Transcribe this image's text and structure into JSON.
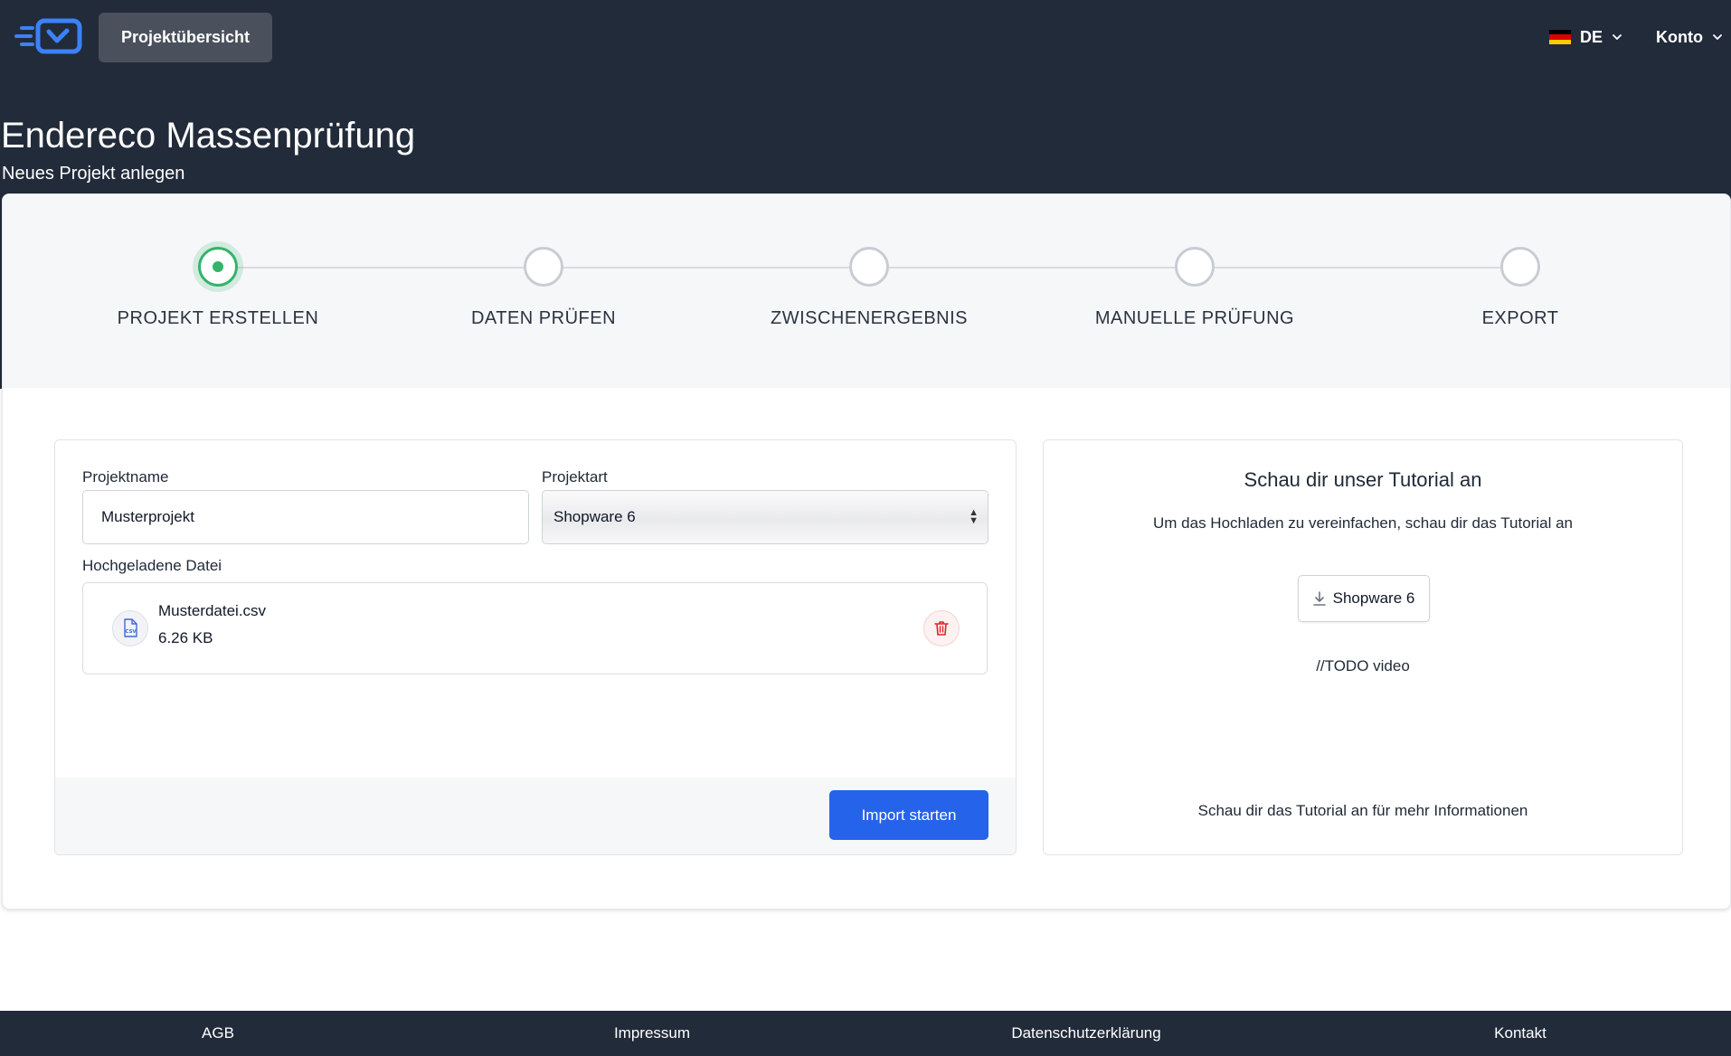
{
  "header": {
    "nav_button": "Projektübersicht",
    "language": "DE",
    "account": "Konto",
    "title": "Endereco Massenprüfung",
    "subtitle": "Neues Projekt anlegen"
  },
  "steps": [
    {
      "label": "PROJEKT ERSTELLEN",
      "active": true
    },
    {
      "label": "DATEN PRÜFEN",
      "active": false
    },
    {
      "label": "ZWISCHENERGEBNIS",
      "active": false
    },
    {
      "label": "MANUELLE PRÜFUNG",
      "active": false
    },
    {
      "label": "EXPORT",
      "active": false
    }
  ],
  "form": {
    "project_name_label": "Projektname",
    "project_name_value": "Musterprojekt",
    "project_type_label": "Projektart",
    "project_type_value": "Shopware 6",
    "uploaded_file_label": "Hochgeladene Datei",
    "file_name": "Musterdatei.csv",
    "file_size": "6.26 KB",
    "file_icon_text": "CSV",
    "submit_label": "Import starten"
  },
  "tutorial": {
    "title": "Schau dir unser Tutorial an",
    "description": "Um das Hochladen zu vereinfachen, schau dir das Tutorial an",
    "download_label": "Shopware 6",
    "placeholder": "//TODO video",
    "footer_text": "Schau dir das Tutorial an für mehr Informationen"
  },
  "footer": {
    "links": [
      "AGB",
      "Impressum",
      "Datenschutzerklärung",
      "Kontakt"
    ]
  },
  "colors": {
    "dark_bg": "#222b3a",
    "accent_blue": "#2563eb",
    "step_active": "#34b36a",
    "danger": "#dc2626",
    "flag_black": "#000000",
    "flag_red": "#dd0000",
    "flag_gold": "#ffce00"
  },
  "icons": [
    "logo-icon",
    "flag-de-icon",
    "chevron-down-icon",
    "csv-file-icon",
    "trash-icon",
    "download-icon"
  ]
}
